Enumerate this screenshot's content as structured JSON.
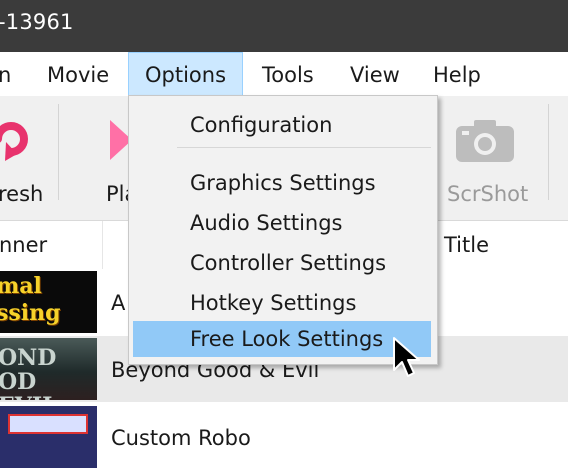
{
  "window": {
    "title": "-13961"
  },
  "menubar": {
    "items": [
      {
        "label": "n"
      },
      {
        "label": "Movie"
      },
      {
        "label": "Options"
      },
      {
        "label": "Tools"
      },
      {
        "label": "View"
      },
      {
        "label": "Help"
      }
    ]
  },
  "toolbar": {
    "refresh_label": "resh",
    "play_label": "Pla",
    "screenshot_label": "ScrShot"
  },
  "columns": {
    "banner": "nner",
    "title": "Title"
  },
  "games": [
    {
      "banner_text": "mal ssing",
      "name": "A"
    },
    {
      "banner_text": "OND OD EVIL",
      "name": "Beyond Good & Evil"
    },
    {
      "banner_text": "",
      "name": "Custom Robo"
    }
  ],
  "options_menu": {
    "items": [
      {
        "label": "Configuration"
      },
      {
        "label": "Graphics Settings"
      },
      {
        "label": "Audio Settings"
      },
      {
        "label": "Controller Settings"
      },
      {
        "label": "Hotkey Settings"
      },
      {
        "label": "Free Look Settings",
        "highlighted": true
      }
    ]
  },
  "colors": {
    "titlebar": "#3b3b3b",
    "menu_active": "#cce8ff",
    "menu_hover": "#91c9f7",
    "refresh_icon": "#e8336d",
    "play_icon": "#ff70a6"
  }
}
